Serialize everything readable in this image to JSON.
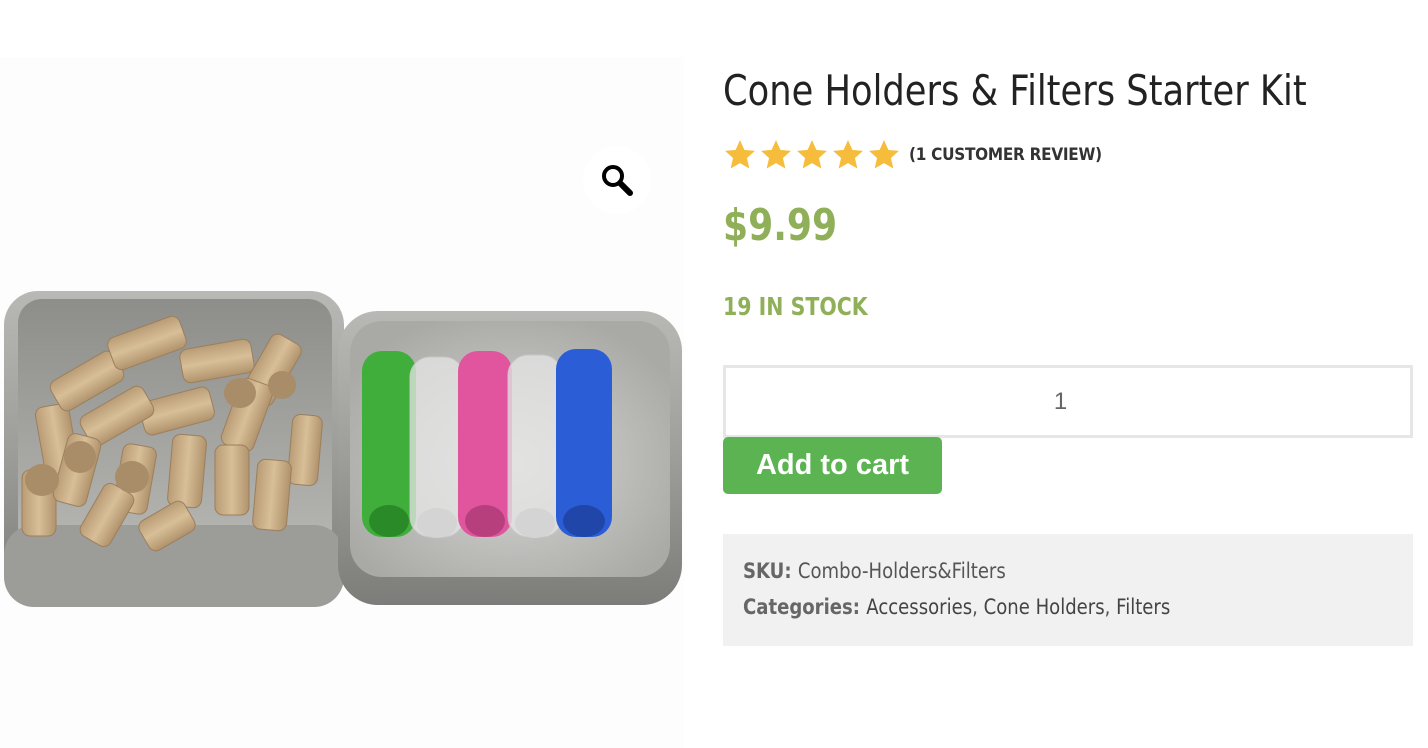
{
  "product": {
    "title": "Cone Holders & Filters Starter Kit",
    "rating": {
      "value": 5,
      "max": 5,
      "color": "#f5bd3b"
    },
    "review_link": "(1 CUSTOMER REVIEW)",
    "price": "$9.99",
    "stock": "19 IN STOCK",
    "accent_color": "#8fb059"
  },
  "cart": {
    "quantity": "1",
    "add_to_cart_label": "Add to cart",
    "button_color": "#5cb352"
  },
  "meta": {
    "sku_label": "SKU:",
    "sku_value": "Combo-Holders&Filters",
    "categories_label": "Categories:",
    "categories": [
      "Accessories",
      "Cone Holders",
      "Filters"
    ],
    "separator": ", "
  },
  "gallery": {
    "zoom_icon": "magnifier-icon"
  }
}
